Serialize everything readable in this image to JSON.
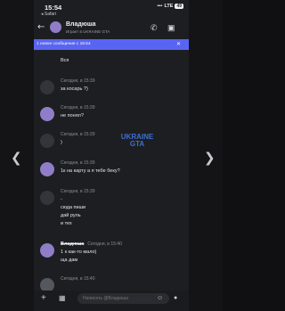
{
  "nav": {
    "prev_icon": "chevron-left-icon",
    "next_icon": "chevron-right-icon"
  },
  "status": {
    "time": "15:54",
    "network": "LTE",
    "battery": "49",
    "back_app": "◂ Safari"
  },
  "header": {
    "name": "Владюша",
    "subtitle": "Играет в UKRAINE GTA"
  },
  "banner": {
    "text": "1 новое сообщение с 15:54"
  },
  "messages": [
    {
      "lines": [
        "Вся"
      ]
    },
    {
      "time": "Сегодня, в 15:39",
      "lines": [
        "за косарь ?)"
      ]
    },
    {
      "time": "Сегодня, в 15:39",
      "lines": [
        "не понял?"
      ]
    },
    {
      "time": "Сегодня, в 15:39",
      "lines": [
        ")"
      ]
    },
    {
      "time": "Сегодня, в 15:39",
      "lines": [
        "1к на карту а я тебе беку?"
      ]
    },
    {
      "time": "Сегодня, в 15:39",
      "lines": [
        "-",
        "сюда пиши",
        "дай руль",
        "и тех"
      ]
    },
    {
      "name": "Владюша",
      "time": "Сегодня, в 15:40",
      "lines": [
        "1 к как-то мало)",
        "ща дам"
      ]
    },
    {
      "time": "Сегодня, в 15:40",
      "lines": []
    }
  ],
  "watermark": {
    "line1": "UKRAINE",
    "line2": "GTA"
  },
  "composer": {
    "placeholder": "Написать @Владюша"
  },
  "colors": {
    "accent": "#5865f2",
    "background": "#1d1e22"
  }
}
